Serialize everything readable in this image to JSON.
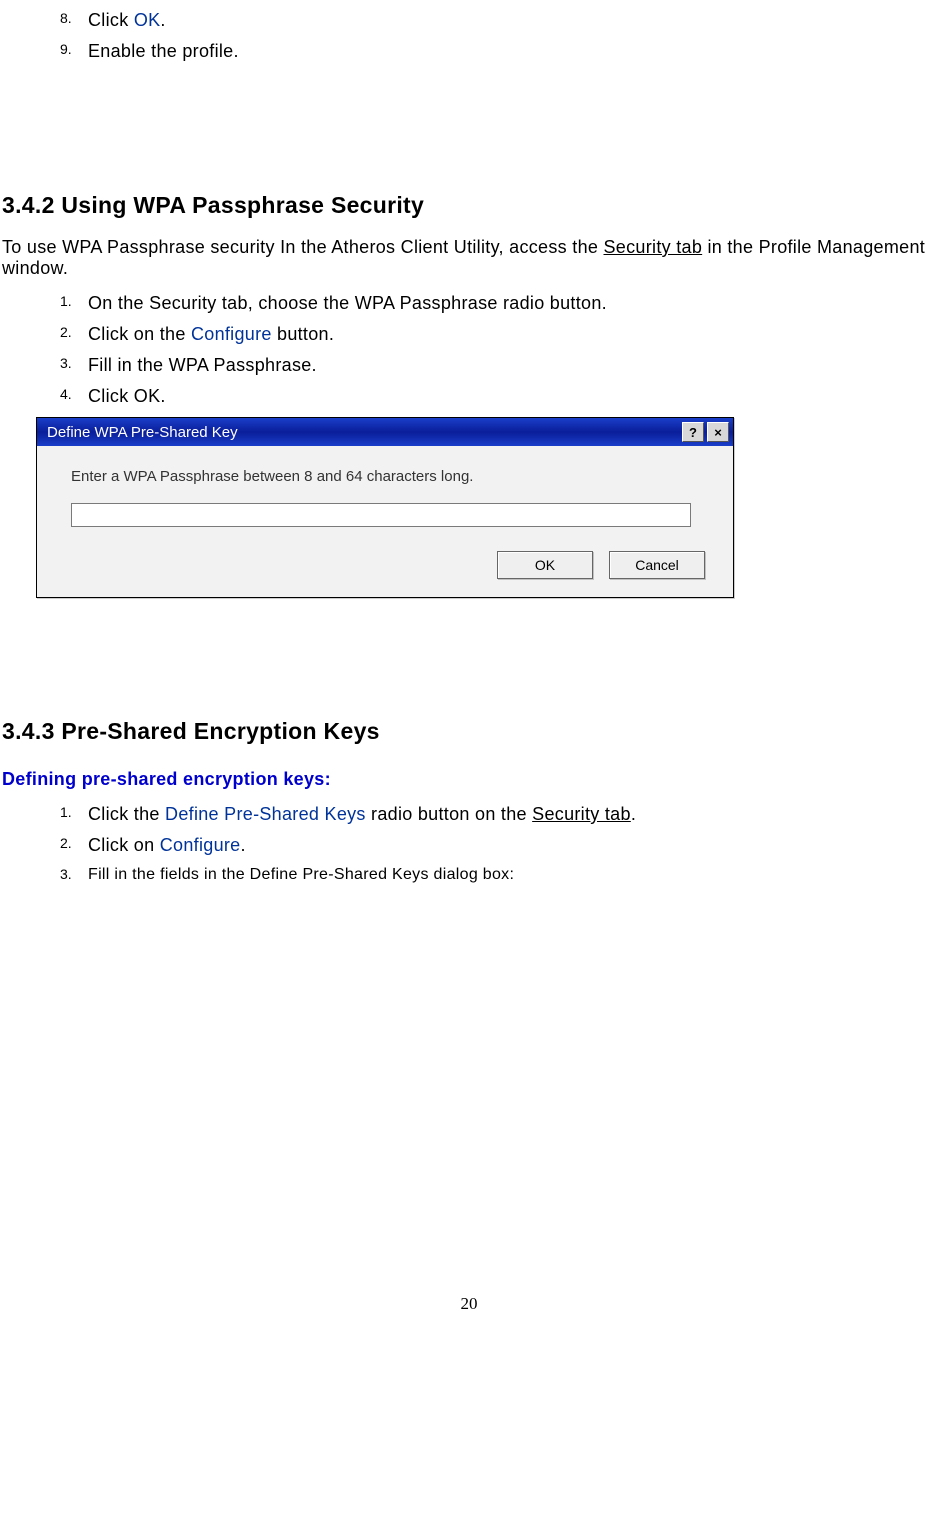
{
  "top_list": {
    "items": [
      {
        "num": "8.",
        "before": "Click ",
        "link": "OK",
        "after": "."
      },
      {
        "num": "9.",
        "before": "Enable the profile.",
        "link": "",
        "after": ""
      }
    ]
  },
  "section342": {
    "heading": "3.4.2  Using WPA Passphrase Security",
    "intro_a": "To use WPA Passphrase security In the Atheros Client Utility, access the ",
    "intro_link": "Security tab",
    "intro_b": " in the Profile Management window.",
    "items": [
      {
        "num": "1.",
        "body": "On the Security tab, choose the WPA Passphrase radio button."
      },
      {
        "num": "2.",
        "before": "Click on the ",
        "link": "Configure",
        "after": " button."
      },
      {
        "num": "3.",
        "body": "Fill in the WPA Passphrase."
      },
      {
        "num": "4.",
        "body": "Click OK."
      }
    ]
  },
  "dialog": {
    "title": "Define WPA Pre-Shared Key",
    "help": "?",
    "close": "×",
    "prompt": "Enter a WPA Passphrase between 8 and 64 characters long.",
    "value": "",
    "ok": "OK",
    "cancel": "Cancel"
  },
  "section343": {
    "heading": "3.4.3 Pre-Shared Encryption Keys",
    "subhead": "Defining pre-shared encryption keys:",
    "items": [
      {
        "num": "1.",
        "before": "Click the ",
        "link": "Define Pre-Shared Keys",
        "mid": " radio button on the ",
        "ulink": "Security tab",
        "after": "."
      },
      {
        "num": "2.",
        "before": "Click on ",
        "link": "Configure",
        "after": "."
      },
      {
        "num": "3.",
        "body": "Fill in the fields in the Define Pre-Shared Keys dialog box:"
      }
    ]
  },
  "page_number": "20"
}
